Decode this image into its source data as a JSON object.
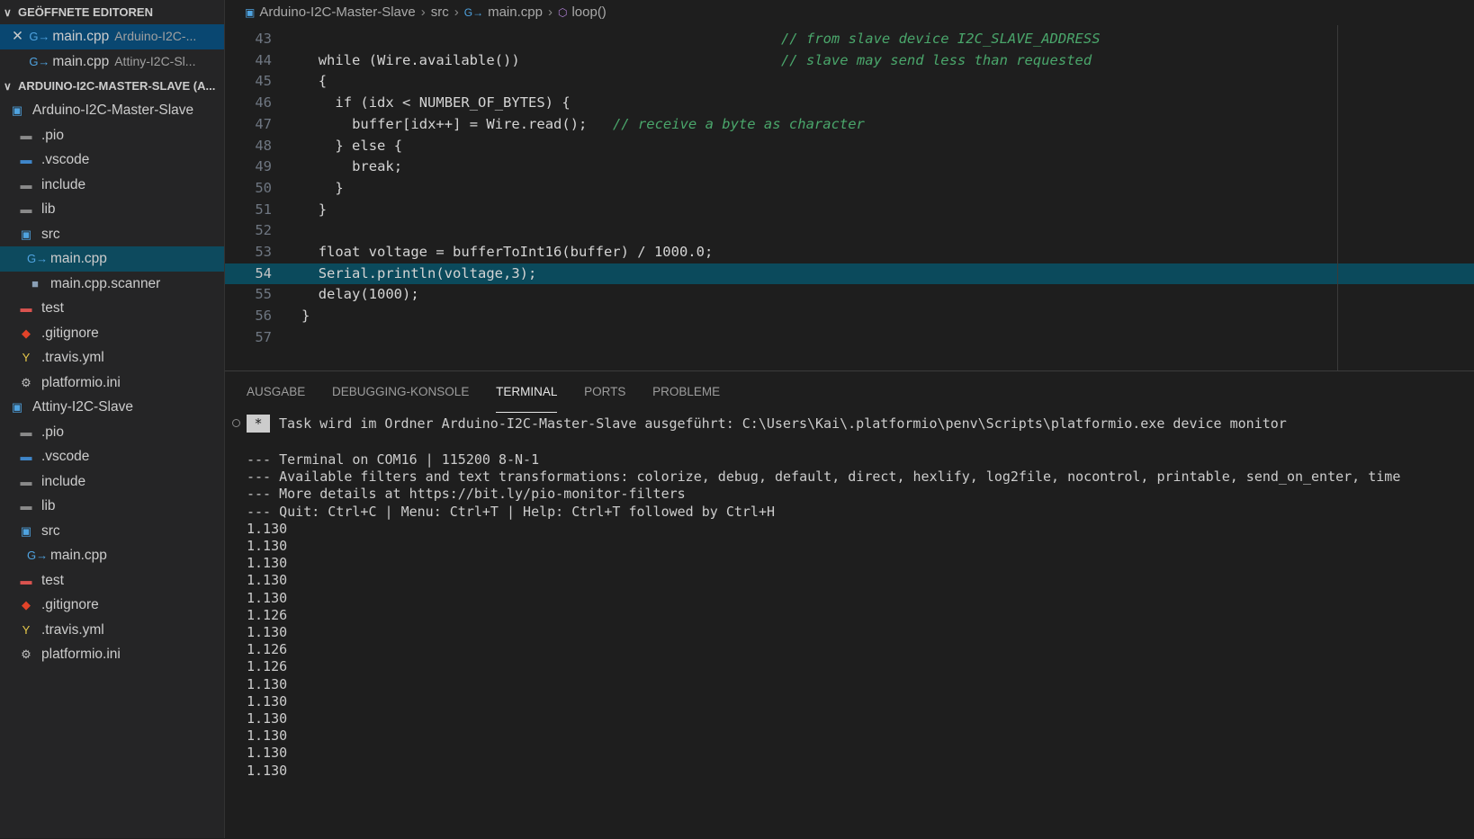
{
  "sidebar": {
    "open_editors_title": "GEÖFFNETE EDITOREN",
    "open_editors": [
      {
        "name": "main.cpp",
        "desc": "Arduino-I2C-..."
      },
      {
        "name": "main.cpp",
        "desc": "Attiny-I2C-Sl..."
      }
    ],
    "workspace_title": "ARDUINO-I2C-MASTER-SLAVE (A...",
    "tree": [
      {
        "label": "Arduino-I2C-Master-Slave",
        "icon": "workspace-folder-icon"
      },
      {
        "label": ".pio",
        "icon": "folder-icon"
      },
      {
        "label": ".vscode",
        "icon": "vscode-folder-icon"
      },
      {
        "label": "include",
        "icon": "folder-icon"
      },
      {
        "label": "lib",
        "icon": "folder-icon"
      },
      {
        "label": "src",
        "icon": "src-folder-icon"
      },
      {
        "label": "main.cpp",
        "icon": "cpp-file-icon"
      },
      {
        "label": "main.cpp.scanner",
        "icon": "file-icon"
      },
      {
        "label": "test",
        "icon": "test-folder-icon"
      },
      {
        "label": ".gitignore",
        "icon": "git-icon"
      },
      {
        "label": ".travis.yml",
        "icon": "yaml-icon"
      },
      {
        "label": "platformio.ini",
        "icon": "gear-icon"
      },
      {
        "label": "Attiny-I2C-Slave",
        "icon": "workspace-folder-icon"
      },
      {
        "label": ".pio",
        "icon": "folder-icon"
      },
      {
        "label": ".vscode",
        "icon": "vscode-folder-icon"
      },
      {
        "label": "include",
        "icon": "folder-icon"
      },
      {
        "label": "lib",
        "icon": "folder-icon"
      },
      {
        "label": "src",
        "icon": "src-folder-icon"
      },
      {
        "label": "main.cpp",
        "icon": "cpp-file-icon"
      },
      {
        "label": "test",
        "icon": "test-folder-icon"
      },
      {
        "label": ".gitignore",
        "icon": "git-icon"
      },
      {
        "label": ".travis.yml",
        "icon": "yaml-icon"
      },
      {
        "label": "platformio.ini",
        "icon": "gear-icon"
      }
    ]
  },
  "breadcrumb": {
    "folder": "Arduino-I2C-Master-Slave",
    "dir": "src",
    "file": "main.cpp",
    "symbol": "loop()"
  },
  "editor": {
    "highlighted_line": "54",
    "lines": [
      {
        "n": "43",
        "comment": "// from slave device I2C_SLAVE_ADDRESS"
      },
      {
        "n": "44",
        "code": "while (Wire.available())",
        "comment": "// slave may send less than requested"
      },
      {
        "n": "45",
        "code": "{"
      },
      {
        "n": "46",
        "code": "if (idx < NUMBER_OF_BYTES) {"
      },
      {
        "n": "47",
        "code": "buffer[idx++] = Wire.read();",
        "comment": "// receive a byte as character"
      },
      {
        "n": "48",
        "code": "} else {"
      },
      {
        "n": "49",
        "code": "break;"
      },
      {
        "n": "50",
        "code": "}"
      },
      {
        "n": "51",
        "code": "}"
      },
      {
        "n": "52",
        "code": ""
      },
      {
        "n": "53",
        "code": "float voltage = bufferToInt16(buffer) / 1000.0;"
      },
      {
        "n": "54",
        "code": "Serial.println(voltage,3);"
      },
      {
        "n": "55",
        "code": "delay(1000);"
      },
      {
        "n": "56",
        "code": "}"
      },
      {
        "n": "57",
        "code": ""
      }
    ]
  },
  "panel": {
    "tabs": [
      "AUSGABE",
      "DEBUGGING-KONSOLE",
      "TERMINAL",
      "PORTS",
      "PROBLEME"
    ],
    "active_tab": "TERMINAL",
    "task_marker": "*",
    "task_line": "Task wird im Ordner Arduino-I2C-Master-Slave ausgeführt: C:\\Users\\Kai\\.platformio\\penv\\Scripts\\platformio.exe device monitor",
    "info_lines": [
      "--- Terminal on COM16 | 115200 8-N-1",
      "--- Available filters and text transformations: colorize, debug, default, direct, hexlify, log2file, nocontrol, printable, send_on_enter, time",
      "--- More details at https://bit.ly/pio-monitor-filters",
      "--- Quit: Ctrl+C | Menu: Ctrl+T | Help: Ctrl+T followed by Ctrl+H"
    ],
    "output_values": [
      "1.130",
      "1.130",
      "1.130",
      "1.130",
      "1.130",
      "1.126",
      "1.130",
      "1.126",
      "1.126",
      "1.130",
      "1.130",
      "1.130",
      "1.130",
      "1.130",
      "1.130"
    ]
  }
}
